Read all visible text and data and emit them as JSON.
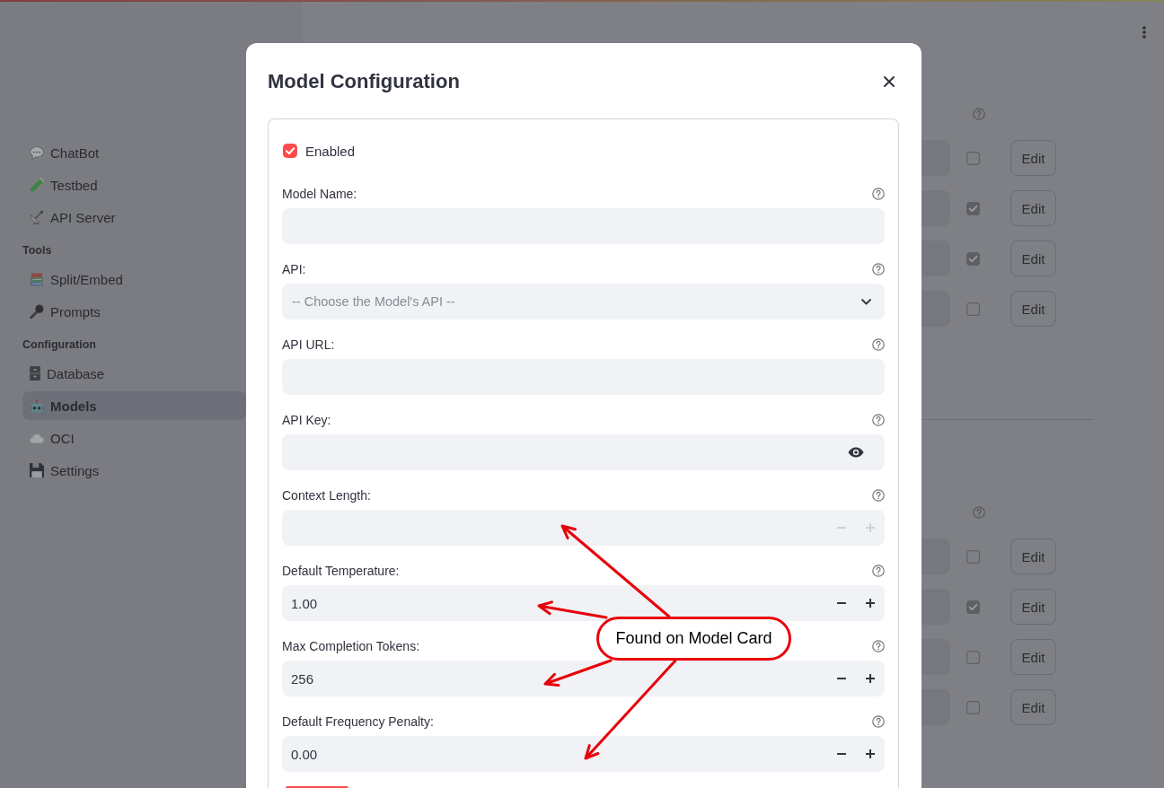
{
  "sidebar": {
    "sections": [
      {
        "items": [
          {
            "label": "ChatBot",
            "selected": false
          },
          {
            "label": "Testbed",
            "selected": false
          },
          {
            "label": "API Server",
            "selected": false
          }
        ]
      },
      {
        "heading": "Tools",
        "items": [
          {
            "label": "Split/Embed",
            "selected": false
          },
          {
            "label": "Prompts",
            "selected": false
          }
        ]
      },
      {
        "heading": "Configuration",
        "items": [
          {
            "label": "Database",
            "selected": false
          },
          {
            "label": "Models",
            "selected": true
          },
          {
            "label": "OCI",
            "selected": false
          },
          {
            "label": "Settings",
            "selected": false
          }
        ]
      }
    ]
  },
  "model_lists": [
    {
      "rows": [
        {
          "checked": false,
          "button": "Edit"
        },
        {
          "checked": true,
          "button": "Edit"
        },
        {
          "checked": true,
          "button": "Edit"
        },
        {
          "checked": false,
          "button": "Edit"
        }
      ]
    },
    {
      "rows": [
        {
          "checked": false,
          "button": "Edit"
        },
        {
          "checked": true,
          "button": "Edit"
        },
        {
          "checked": false,
          "button": "Edit"
        },
        {
          "checked": false,
          "button": "Edit"
        }
      ]
    }
  ],
  "dialog": {
    "title": "Model Configuration",
    "enabled": {
      "label": "Enabled",
      "checked": true
    },
    "fields": [
      {
        "kind": "text",
        "label": "Model Name:"
      },
      {
        "kind": "select",
        "label": "API:",
        "placeholder": "-- Choose the Model's API --"
      },
      {
        "kind": "text",
        "label": "API URL:"
      },
      {
        "kind": "password",
        "label": "API Key:"
      },
      {
        "kind": "number",
        "label": "Context Length:",
        "steppers_disabled": true
      },
      {
        "kind": "number",
        "label": "Default Temperature:",
        "value": "1.00",
        "steppers_disabled": false
      },
      {
        "kind": "number",
        "label": "Max Completion Tokens:",
        "value": "256",
        "steppers_disabled": false
      },
      {
        "kind": "number",
        "label": "Default Frequency Penalty:",
        "value": "0.00",
        "steppers_disabled": false
      }
    ]
  },
  "annotation": {
    "label": "Found on Model Card"
  }
}
